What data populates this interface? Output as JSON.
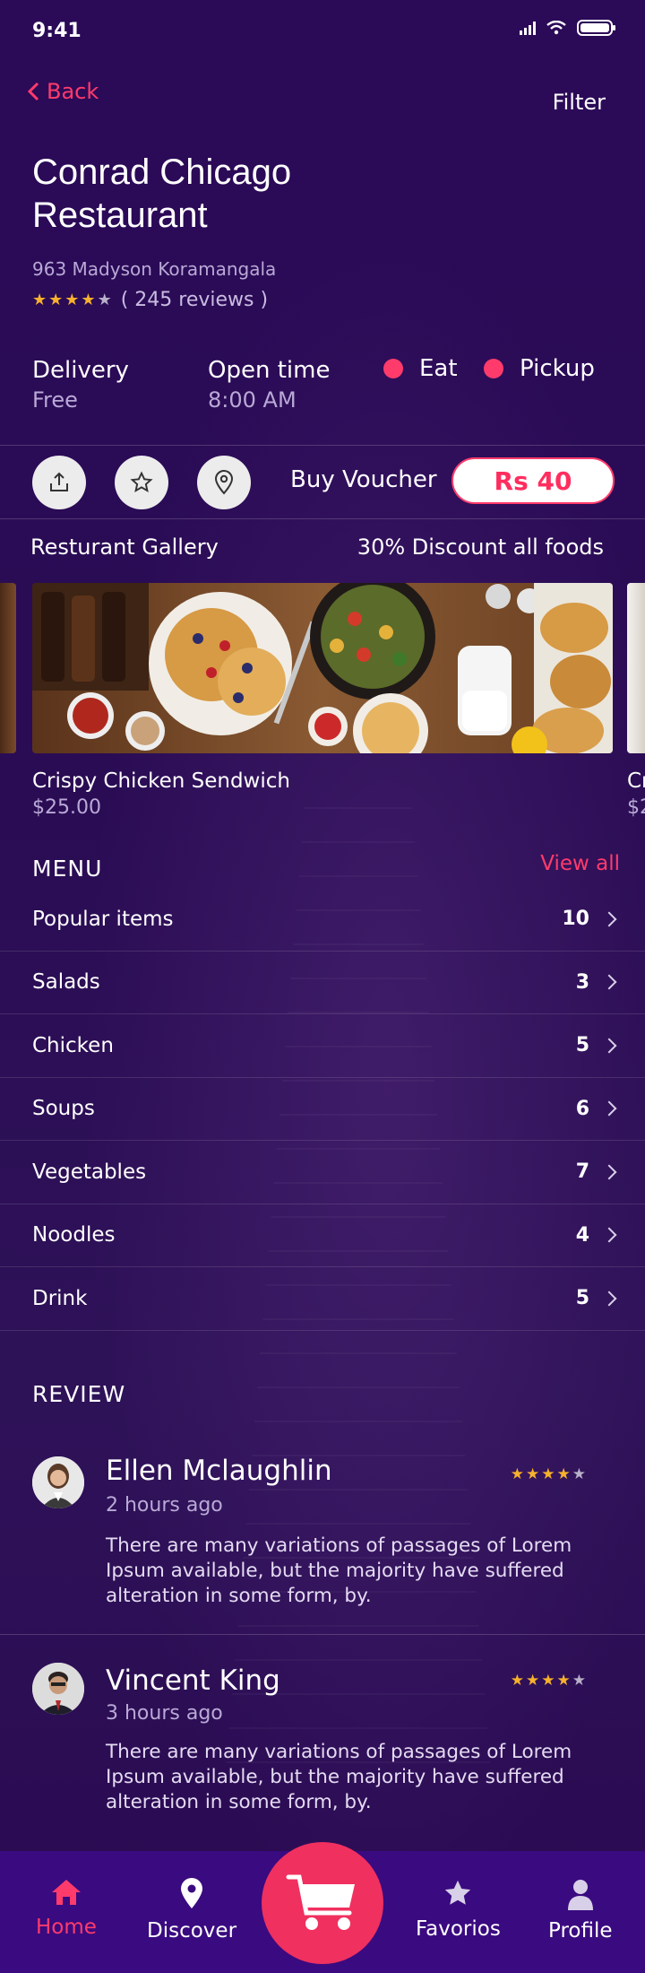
{
  "status_bar": {
    "time": "9:41"
  },
  "nav": {
    "back_label": "Back",
    "filter_label": "Filter"
  },
  "restaurant": {
    "name": "Conrad Chicago Restaurant",
    "address": "963 Madyson Koramangala",
    "rating": 4,
    "rating_max": 5,
    "reviews_text": "( 245 reviews )"
  },
  "info": {
    "delivery_label": "Delivery",
    "delivery_value": "Free",
    "open_label": "Open time",
    "open_value": "8:00 AM",
    "option_eat": "Eat",
    "option_pickup": "Pickup"
  },
  "actions": {
    "icons": [
      "share-icon",
      "star-icon",
      "location-pin-icon"
    ],
    "voucher_label": "Buy Voucher",
    "voucher_price": "Rs 40"
  },
  "gallery": {
    "title": "Resturant Gallery",
    "discount": "30% Discount all foods",
    "item": {
      "name": "Crispy Chicken Sendwich",
      "price": "$25.00"
    },
    "next_item": {
      "name": "Cr",
      "price": "$2"
    }
  },
  "menu": {
    "title": "MENU",
    "view_all": "View all",
    "items": [
      {
        "label": "Popular items",
        "count": "10"
      },
      {
        "label": "Salads",
        "count": "3"
      },
      {
        "label": "Chicken",
        "count": "5"
      },
      {
        "label": "Soups",
        "count": "6"
      },
      {
        "label": "Vegetables",
        "count": "7"
      },
      {
        "label": "Noodles",
        "count": "4"
      },
      {
        "label": "Drink",
        "count": "5"
      }
    ]
  },
  "reviews": {
    "title": "REVIEW",
    "items": [
      {
        "name": "Ellen Mclaughlin",
        "time": "2 hours ago",
        "stars": 4,
        "text": "There are many variations of passages of Lorem Ipsum available, but the majority have suffered alteration in some form, by."
      },
      {
        "name": "Vincent King",
        "time": "3 hours ago",
        "stars": 4,
        "text": "There are many variations of passages of Lorem Ipsum available, but the majority have suffered alteration in some form, by."
      }
    ]
  },
  "bottom_nav": {
    "home": "Home",
    "discover": "Discover",
    "favorites": "Favorios",
    "profile": "Profile",
    "active": "home"
  },
  "colors": {
    "accent": "#ff3b6b",
    "background": "#2a0a55",
    "star": "#f7b12b",
    "nav_bg": "#3a0a80"
  }
}
